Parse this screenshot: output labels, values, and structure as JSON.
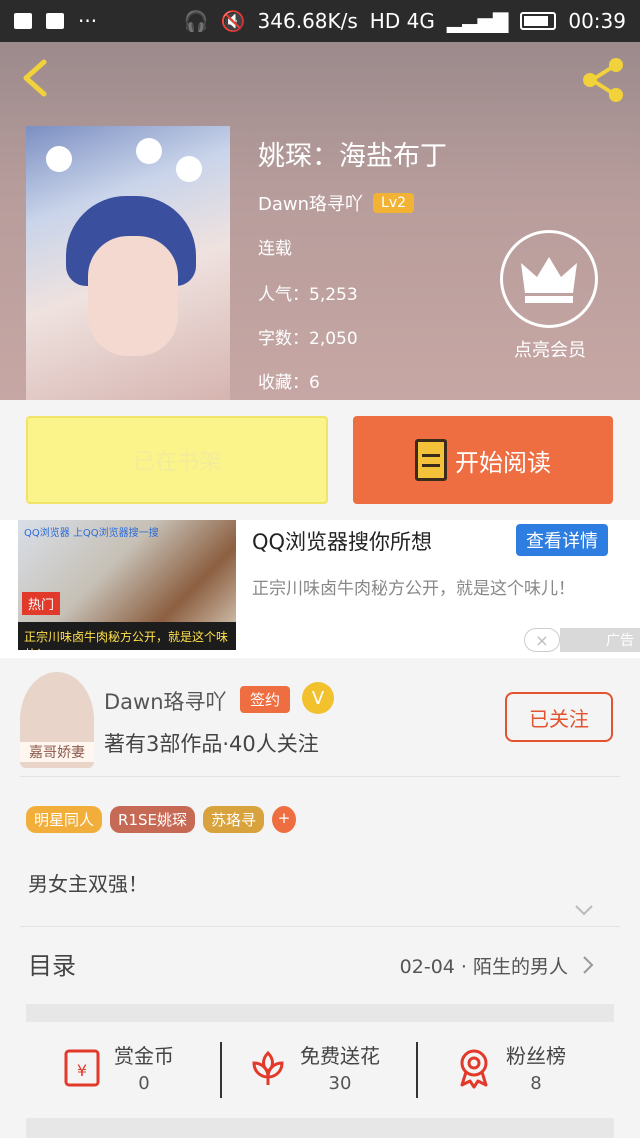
{
  "status_bar": {
    "speed": "346.68K/s",
    "network": "HD 4G",
    "time": "00:39"
  },
  "book": {
    "title": "姚琛：海盐布丁",
    "author": "Dawn珞寻吖",
    "level": "Lv2",
    "status": "连载",
    "popularity": "人气：5,253",
    "word_count": "字数：2,050",
    "favorites": "收藏：6",
    "vip_label": "点亮会员"
  },
  "buttons": {
    "shelf": "已在书架",
    "read": "开始阅读"
  },
  "ad": {
    "title": "QQ浏览器搜你所想",
    "desc": "正宗川味卤牛肉秘方公开，就是这个味儿！",
    "cta": "查看详情",
    "tag": "广告",
    "close": "×",
    "image_brand": "QQ浏览器",
    "image_search": "上QQ浏览器搜一搜",
    "image_hot": "热门",
    "image_caption": "正宗川味卤牛肉秘方公开，就是这个味儿！"
  },
  "author_card": {
    "name": "Dawn珞寻吖",
    "sign_badge": "签约",
    "v_badge": "V",
    "works": "著有3部作品·40人关注",
    "follow": "已关注",
    "avatar_caption": "嘉哥娇妻"
  },
  "tags": [
    "明星同人",
    "R1SE姚琛",
    "苏珞寻",
    "+"
  ],
  "summary": "男女主双强！",
  "toc": {
    "label": "目录",
    "latest": "02-04 · 陌生的男人"
  },
  "actions": [
    {
      "label": "赏金币",
      "value": "0",
      "icon": "red-envelope-icon"
    },
    {
      "label": "免费送花",
      "value": "30",
      "icon": "flower-icon"
    },
    {
      "label": "粉丝榜",
      "value": "8",
      "icon": "medal-icon"
    }
  ],
  "colors": {
    "accent": "#ee6e42",
    "shelf_button": "#fbf48a",
    "ad_button": "#2d7ee0"
  }
}
